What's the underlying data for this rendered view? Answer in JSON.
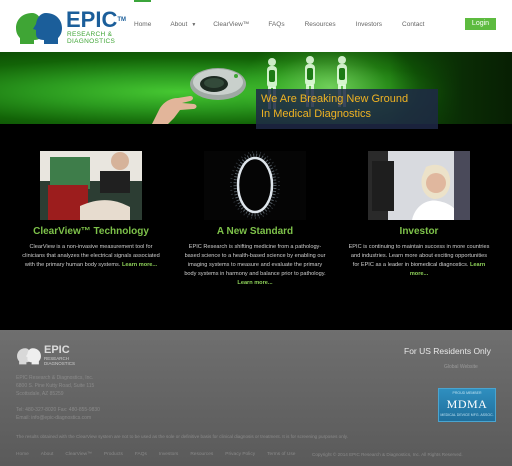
{
  "header": {
    "logo": {
      "name": "EPIC",
      "tm": "TM",
      "line1": "RESEARCH &",
      "line2": "DIAGNOSTICS"
    },
    "nav": [
      {
        "label": "Home",
        "active": true
      },
      {
        "label": "About",
        "dropdown": true
      },
      {
        "label": "ClearView™"
      },
      {
        "label": "FAQs"
      },
      {
        "label": "Resources"
      },
      {
        "label": "Investors"
      },
      {
        "label": "Contact"
      }
    ],
    "login_label": "Login"
  },
  "banner": {
    "line1": "We Are Breaking New Ground",
    "line2": "In Medical Diagnostics"
  },
  "features": [
    {
      "title": "ClearView™ Technology",
      "desc": "ClearView is a non-invasive measurement tool for clinicians that analyzes the electrical signals associated with the primary human body systems.",
      "more": "Learn more..."
    },
    {
      "title": "A New Standard",
      "desc": "EPIC Research is shifting medicine from a pathology-based science to a health-based science by enabling our imaging systems to measure and evaluate the primary body systems in harmony and balance prior to pathology.",
      "more": "Learn more..."
    },
    {
      "title": "Investor",
      "desc": "EPIC is continuing to maintain success in more countries and industries. Learn more about exciting opportunities for EPIC as a leader in biomedical diagnostics.",
      "more": "Learn more..."
    }
  ],
  "footer": {
    "logo": {
      "name": "EPIC",
      "line1": "RESEARCH",
      "line2": "DIAGNOSTICS"
    },
    "address": [
      "EPIC Research & Diagnostics, Inc.",
      "6800 S. Pine Kutty Road, Suite 115",
      "Scottsdale, AZ 85259"
    ],
    "contact": [
      "Tel: 480-327-8020 Fax: 480-855-9830",
      "Email: info@epic-diagnostics.com"
    ],
    "us_residents": "For US Residents Only",
    "global_site": "Global Website",
    "mdma": {
      "top": "PROUD MEMBER",
      "main": "MDMA",
      "bottom": "MEDICAL DEVICE MFG. ASSOC."
    },
    "disclaimer": "The results obtained with the ClearView system are not to be used as the sole or definitive basis for clinical diagnosis or treatment. It is for screening purposes only.",
    "nav": [
      "Home",
      "About",
      "ClearView™",
      "Products",
      "FAQs",
      "Investors",
      "Resources",
      "Privacy Policy",
      "Terms of Use"
    ],
    "copyright": "Copyright © 2014 EPIC Research & Diagnostics, Inc. All Rights Reserved."
  },
  "colors": {
    "brand_blue": "#1b5e9a",
    "brand_green": "#3fa535",
    "feature_title": "#7ec24a",
    "banner_text": "#f0b323"
  }
}
